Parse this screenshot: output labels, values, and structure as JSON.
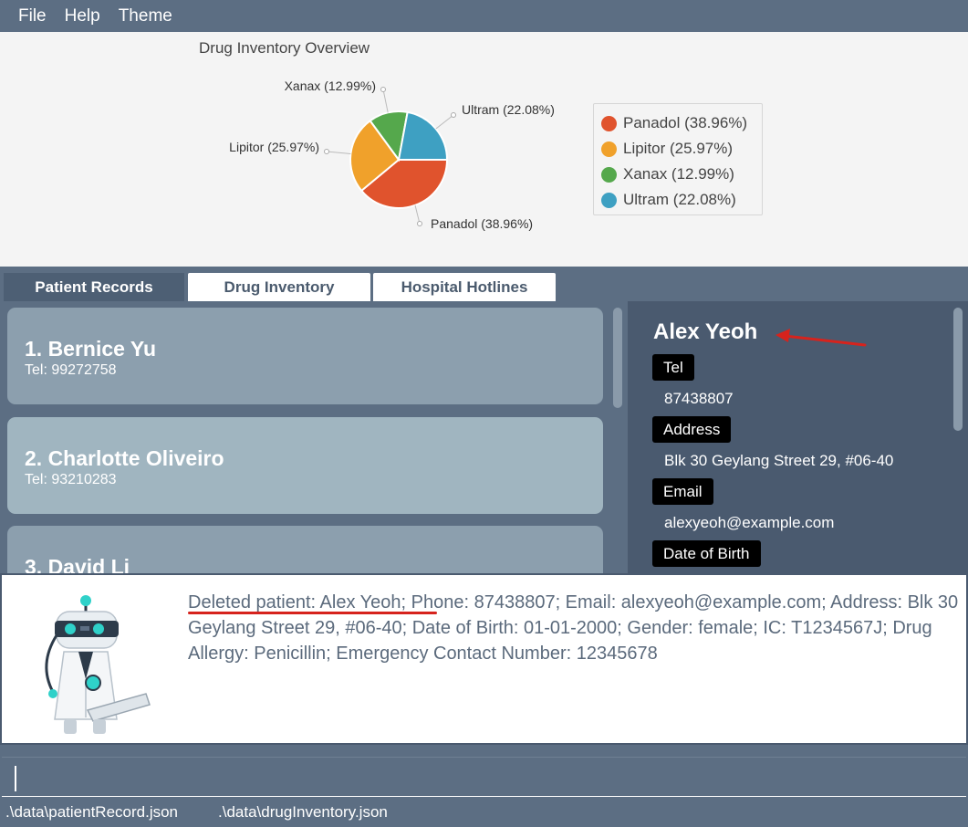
{
  "menu": {
    "items": [
      "File",
      "Help",
      "Theme"
    ]
  },
  "chart_data": {
    "type": "pie",
    "title": "Drug Inventory Overview",
    "series": [
      {
        "name": "Panadol",
        "value": 38.96,
        "label": "Panadol (38.96%)",
        "color": "#e0532d"
      },
      {
        "name": "Lipitor",
        "value": 25.97,
        "label": "Lipitor (25.97%)",
        "color": "#f0a12b"
      },
      {
        "name": "Xanax",
        "value": 12.99,
        "label": "Xanax (12.99%)",
        "color": "#55a84c"
      },
      {
        "name": "Ultram",
        "value": 22.08,
        "label": "Ultram (22.08%)",
        "color": "#3ea0c2"
      }
    ],
    "legend_position": "right"
  },
  "tabs": [
    "Patient Records",
    "Drug Inventory",
    "Hospital Hotlines"
  ],
  "patients": [
    {
      "name": "1.  Bernice Yu",
      "tel": "Tel: 99272758",
      "color": "#8c9fae"
    },
    {
      "name": "2.  Charlotte Oliveiro",
      "tel": "Tel: 93210283",
      "color": "#a0b5c0"
    },
    {
      "name": "3.  David Li",
      "tel": "",
      "color": "#8c9fae"
    }
  ],
  "detail": {
    "name": "Alex Yeoh",
    "tel_label": "Tel",
    "tel": "87438807",
    "address_label": "Address",
    "address": "Blk 30 Geylang Street 29, #06-40",
    "email_label": "Email",
    "email": "alexyeoh@example.com",
    "dob_label": "Date of Birth"
  },
  "result": {
    "text": "Deleted patient: Alex Yeoh; Phone: 87438807; Email: alexyeoh@example.com; Address: Blk 30 Geylang Street 29, #06-40; Date of Birth: 01-01-2000; Gender: female; IC: T1234567J; Drug Allergy: Penicillin; Emergency Contact Number: 12345678"
  },
  "command": {
    "value": ""
  },
  "status": {
    "patient_file": ".\\data\\patientRecord.json",
    "drug_file": ".\\data\\drugInventory.json"
  },
  "colors": {
    "accent_arrow": "#d6231d"
  }
}
